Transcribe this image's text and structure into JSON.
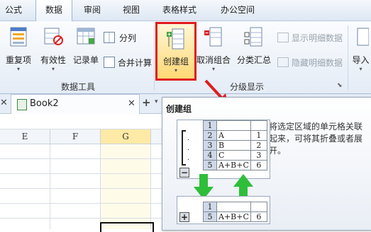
{
  "tabs": [
    "公式",
    "数据",
    "审阅",
    "视图",
    "表格样式",
    "办公空间"
  ],
  "ribbon": {
    "data_tools": {
      "dedupe": "重复项",
      "validity": "有效性",
      "record_form": "记录单",
      "split_column": "分列",
      "consolidate": "合并计算",
      "label": "数据工具"
    },
    "outline": {
      "create_group": "创建组",
      "ungroup": "取消组合",
      "subtotal": "分类汇总",
      "show_detail": "显示明细数据",
      "hide_detail": "隐藏明细数据",
      "label": "分级显示"
    },
    "import": "导入"
  },
  "doc_tab": {
    "name": "Book2",
    "add": "+"
  },
  "columns": [
    "E",
    "F",
    "G"
  ],
  "tooltip": {
    "title": "创建组",
    "description": "将选定区域的单元格关联起来，可将其折叠或者展开。",
    "expanded": {
      "rows": [
        {
          "n": "1",
          "a": "",
          "b": ""
        },
        {
          "n": "2",
          "a": "A",
          "b": "1"
        },
        {
          "n": "3",
          "a": "B",
          "b": "2"
        },
        {
          "n": "4",
          "a": "C",
          "b": "3"
        },
        {
          "n": "5",
          "a": "A+B+C",
          "b": "6"
        }
      ],
      "collapse_btn": "−"
    },
    "collapsed": {
      "rows": [
        {
          "n": "1",
          "a": "",
          "b": ""
        },
        {
          "n": "5",
          "a": "A+B+C",
          "b": "6"
        }
      ],
      "expand_btn": "+"
    }
  },
  "colors": {
    "highlight_red": "#e0191f",
    "arrow_red": "#e01d1d",
    "arrow_green": "#2fbe3a",
    "selected_col": "#fff3bf"
  }
}
